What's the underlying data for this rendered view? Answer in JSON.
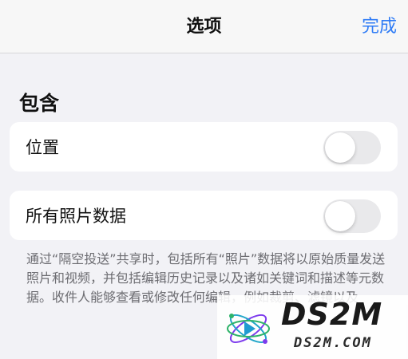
{
  "navbar": {
    "title": "选项",
    "done_label": "完成"
  },
  "section": {
    "header": "包含"
  },
  "rows": [
    {
      "label": "位置",
      "enabled": false
    },
    {
      "label": "所有照片数据",
      "enabled": false
    }
  ],
  "footnote": "通过“隔空投送”共享时，包括所有“照片”数据将以原始质量发送照片和视频，并包括编辑历史记录以及诸如关键词和描述等元数据。收件人能够查看或修改任何编辑，例如裁剪、滤镜以及",
  "watermark": {
    "main": "DS2M",
    "sub": "DS2M.COM"
  },
  "colors": {
    "accent": "#2f7cf6",
    "background": "#f2f2f6",
    "card": "#ffffff",
    "switch_off": "#e9e9eb",
    "footnote_text": "#6d6d72"
  },
  "icons": {
    "watermark_logo": "ds2m-logo-icon"
  }
}
